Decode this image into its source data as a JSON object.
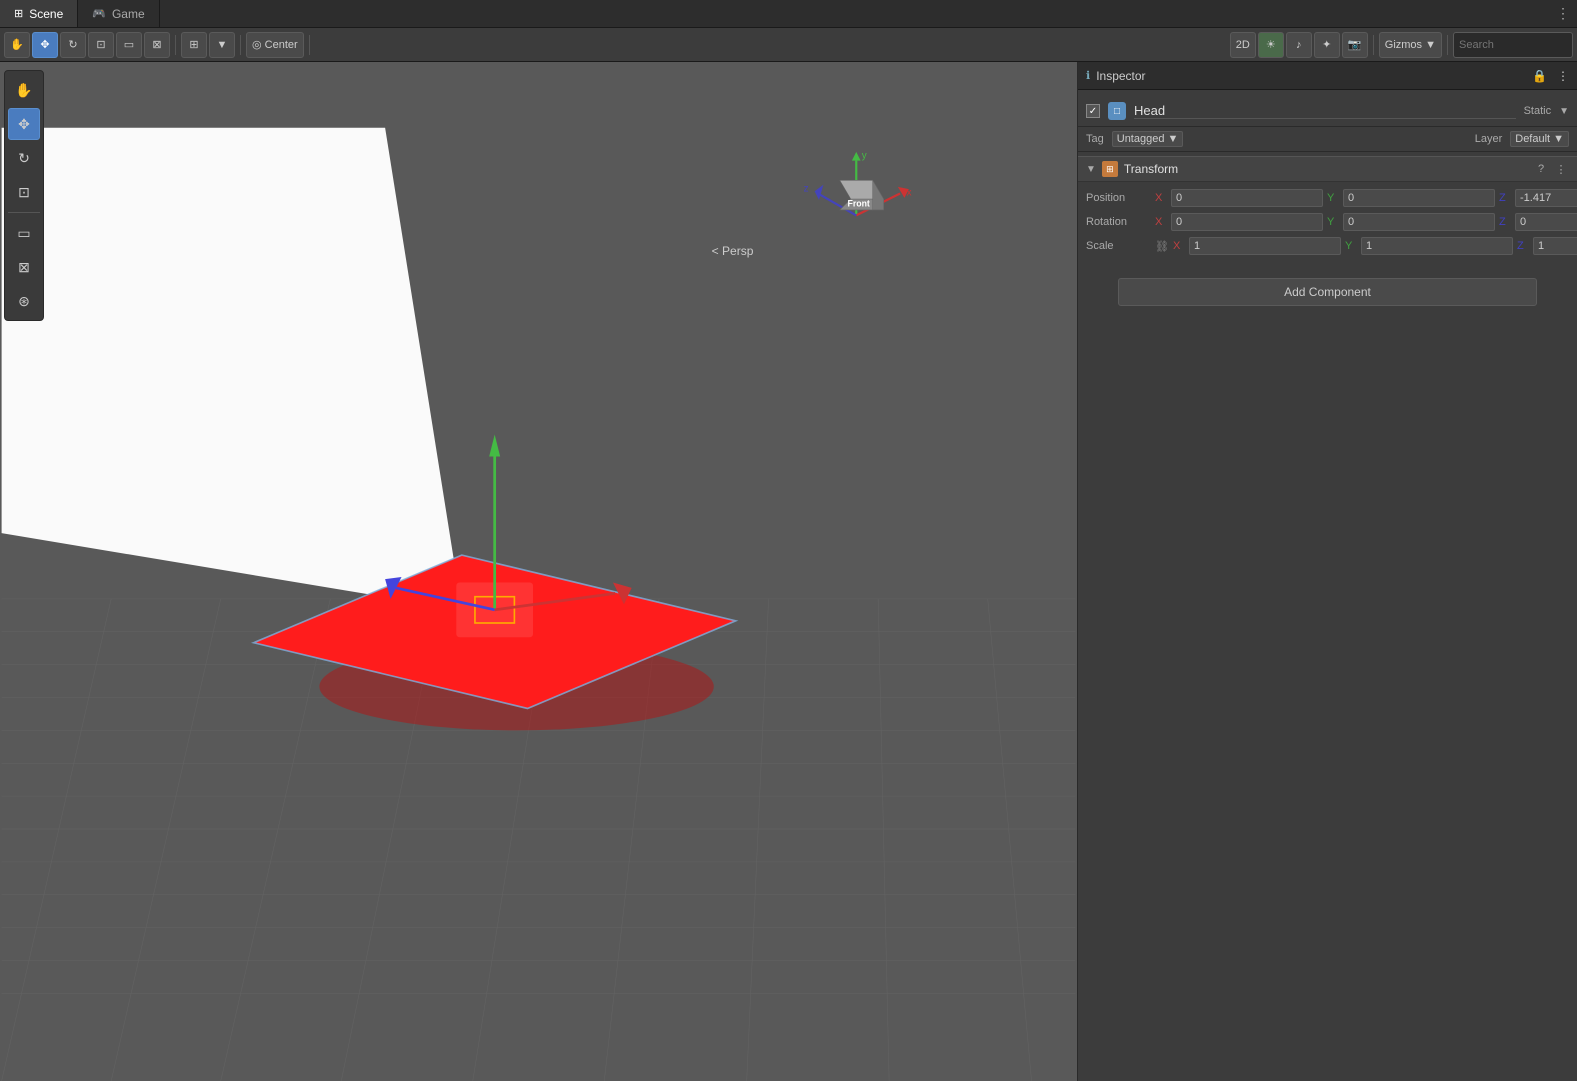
{
  "tabs": {
    "scene": {
      "label": "Scene",
      "icon": "⊞"
    },
    "game": {
      "label": "Game",
      "icon": "🎮"
    },
    "menu_icon": "⋮"
  },
  "toolbar": {
    "move_icon": "✥",
    "scale_icon": "⊡",
    "rotate_icon": "↻",
    "rect_icon": "⊞",
    "transform_icon": "⊠",
    "snapping_icon": "⊞",
    "2d_label": "2D",
    "light_icon": "☀",
    "audio_icon": "♪",
    "fx_icon": "✦",
    "camera_icon": "⊡",
    "gizmos_label": "Gizmos",
    "search_placeholder": "Search"
  },
  "toolbox": {
    "hand_icon": "✋",
    "move_icon": "✥",
    "rotate_icon": "↻",
    "scale_icon": "⊡",
    "rect_icon": "⊞",
    "transform_icon": "⊠",
    "custom_icon": "⊛"
  },
  "scene": {
    "persp_label": "< Persp"
  },
  "inspector": {
    "title": "Inspector",
    "lock_icon": "🔒",
    "menu_icon": "⋮",
    "gameobject": {
      "name": "Head",
      "static_label": "Static",
      "static_arrow": "▼",
      "checkbox_checked": "✓",
      "icon": "□"
    },
    "tag_row": {
      "tag_label": "Tag",
      "tag_value": "Untagged",
      "tag_arrow": "▼",
      "layer_label": "Layer",
      "layer_value": "Default",
      "layer_arrow": "▼"
    },
    "transform": {
      "component_name": "Transform",
      "arrow": "▼",
      "help_icon": "?",
      "settings_icon": "⋮",
      "position_label": "Position",
      "rotation_label": "Rotation",
      "scale_label": "Scale",
      "link_icon": "⛓",
      "x_label": "X",
      "y_label": "Y",
      "z_label": "Z",
      "position": {
        "x": "0",
        "y": "0",
        "z": "-1.417"
      },
      "rotation": {
        "x": "0",
        "y": "0",
        "z": "0"
      },
      "scale": {
        "x": "1",
        "y": "1",
        "z": "1"
      }
    },
    "add_component_label": "Add Component"
  }
}
